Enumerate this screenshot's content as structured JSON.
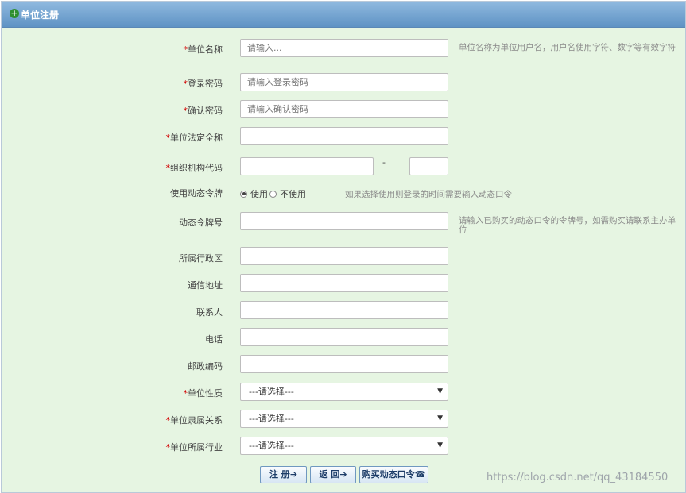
{
  "header": {
    "title": "单位注册",
    "icon": "plus-circle-icon"
  },
  "form": {
    "unit_name": {
      "label": "单位名称",
      "placeholder": "请输入...",
      "hint": "单位名称为单位用户名，用户名使用字符、数字等有效字符"
    },
    "login_password": {
      "label": "登录密码",
      "placeholder": "请输入登录密码"
    },
    "confirm_password": {
      "label": "确认密码",
      "placeholder": "请输入确认密码"
    },
    "legal_full_name": {
      "label": "单位法定全称",
      "value": ""
    },
    "org_code": {
      "label": "组织机构代码",
      "separator": "-",
      "value_main": "",
      "value_suffix": ""
    },
    "dynamic_token": {
      "label": "使用动态令牌",
      "options": [
        "使用",
        "不使用"
      ],
      "selected": "使用",
      "hint": "如果选择使用则登录的时间需要输入动态口令"
    },
    "token_number": {
      "label": "动态令牌号",
      "value": "",
      "hint": "请输入已购买的动态口令的令牌号，如需购买请联系主办单位"
    },
    "admin_region": {
      "label": "所属行政区",
      "value": ""
    },
    "address": {
      "label": "通信地址",
      "value": ""
    },
    "contact": {
      "label": "联系人",
      "value": ""
    },
    "phone": {
      "label": "电话",
      "value": ""
    },
    "postcode": {
      "label": "邮政编码",
      "value": ""
    },
    "unit_nature": {
      "label": "单位性质",
      "selected": "---请选择---"
    },
    "affiliation": {
      "label": "单位隶属关系",
      "selected": "---请选择---"
    },
    "industry": {
      "label": "单位所属行业",
      "selected": "---请选择---"
    },
    "required_mark": "*"
  },
  "buttons": {
    "register": "注 册",
    "back": "返 回",
    "buy_token": "购买动态口令"
  },
  "watermark": "https://blog.csdn.net/qq_43184550",
  "colors": {
    "header_top": "#8fb9df",
    "header_bottom": "#5f93c4",
    "form_bg": "#e6f5e2",
    "required": "#d30000"
  }
}
